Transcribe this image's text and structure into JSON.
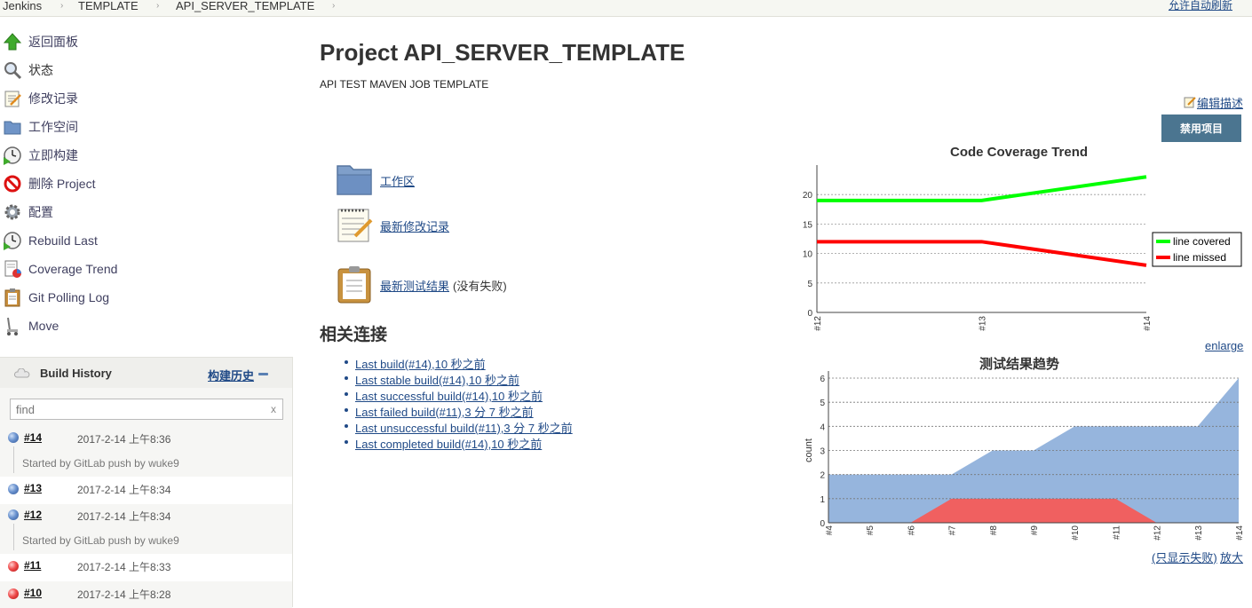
{
  "breadcrumb": {
    "items": [
      "Jenkins",
      "TEMPLATE",
      "API_SERVER_TEMPLATE"
    ],
    "auto_refresh": "允许自动刷新"
  },
  "sidebar": {
    "items": [
      {
        "label": "返回面板",
        "icon": "up-arrow-icon"
      },
      {
        "label": "状态",
        "icon": "magnifier-icon"
      },
      {
        "label": "修改记录",
        "icon": "notepad-icon"
      },
      {
        "label": "工作空间",
        "icon": "folder-icon"
      },
      {
        "label": "立即构建",
        "icon": "clock-play-icon"
      },
      {
        "label": "删除 Project",
        "icon": "no-entry-icon"
      },
      {
        "label": "配置",
        "icon": "gear-icon"
      },
      {
        "label": "Rebuild Last",
        "icon": "clock-play-icon"
      },
      {
        "label": "Coverage Trend",
        "icon": "report-icon"
      },
      {
        "label": "Git Polling Log",
        "icon": "clipboard-icon"
      },
      {
        "label": "Move",
        "icon": "move-icon"
      }
    ]
  },
  "build_history": {
    "title": "Build History",
    "link": "构建历史",
    "find_placeholder": "find",
    "clear": "x",
    "builds": [
      {
        "num": "#14",
        "date": "2017-2-14 上午8:36",
        "status": "blue",
        "cause": "Started by GitLab push by wuke9"
      },
      {
        "num": "#13",
        "date": "2017-2-14 上午8:34",
        "status": "blue",
        "cause": ""
      },
      {
        "num": "#12",
        "date": "2017-2-14 上午8:34",
        "status": "blue",
        "cause": "Started by GitLab push by wuke9"
      },
      {
        "num": "#11",
        "date": "2017-2-14 上午8:33",
        "status": "red",
        "cause": ""
      },
      {
        "num": "#10",
        "date": "2017-2-14 上午8:28",
        "status": "red",
        "cause": ""
      }
    ]
  },
  "main": {
    "title": "Project API_SERVER_TEMPLATE",
    "description": "API TEST MAVEN JOB TEMPLATE",
    "edit_description": "编辑描述",
    "disable_button": "禁用项目",
    "links": [
      {
        "label": "工作区",
        "icon": "folder-icon",
        "aside": ""
      },
      {
        "label": "最新修改记录",
        "icon": "notepad-icon",
        "aside": ""
      },
      {
        "label": "最新测试结果",
        "icon": "clipboard-icon",
        "aside": "(没有失败)"
      }
    ],
    "related_heading": "相关连接",
    "permalinks": [
      "Last build(#14),10 秒之前",
      "Last stable build(#14),10 秒之前",
      "Last successful build(#14),10 秒之前",
      "Last failed build(#11),3 分 7 秒之前",
      "Last unsuccessful build(#11),3 分 7 秒之前",
      "Last completed build(#14),10 秒之前"
    ],
    "enlarge": "enlarge",
    "only_failed": "(只显示失败)",
    "zoom": "放大"
  },
  "colors": {
    "covered": "#00ff00",
    "missed": "#ff0000",
    "pass_area": "#96b5dd",
    "fail_area": "#f06060",
    "disable_button": "#4b7590"
  },
  "chart_data": [
    {
      "type": "line",
      "title": "Code Coverage Trend",
      "x": [
        "#12",
        "#13",
        "#14"
      ],
      "ylim": [
        0,
        25
      ],
      "yticks": [
        0,
        5,
        10,
        15,
        20
      ],
      "grid": true,
      "legend_placement": "right",
      "series": [
        {
          "name": "line covered",
          "color": "#00ff00",
          "values": [
            19,
            19,
            23
          ]
        },
        {
          "name": "line missed",
          "color": "#ff0000",
          "values": [
            12,
            12,
            8
          ]
        }
      ]
    },
    {
      "type": "area",
      "title": "测试结果趋势",
      "ylabel": "count",
      "x": [
        "#4",
        "#5",
        "#6",
        "#7",
        "#8",
        "#9",
        "#10",
        "#11",
        "#12",
        "#13",
        "#14"
      ],
      "ylim": [
        0,
        6
      ],
      "yticks": [
        0,
        1,
        2,
        3,
        4,
        5,
        6
      ],
      "grid": true,
      "series": [
        {
          "name": "",
          "role": "total",
          "color": "#96b5dd",
          "values": [
            2,
            2,
            2,
            2,
            3,
            3,
            4,
            4,
            4,
            4,
            6
          ]
        },
        {
          "name": "",
          "role": "failed",
          "color": "#f06060",
          "values": [
            0,
            0,
            0,
            1,
            1,
            1,
            1,
            1,
            0,
            0,
            0
          ]
        }
      ]
    }
  ]
}
